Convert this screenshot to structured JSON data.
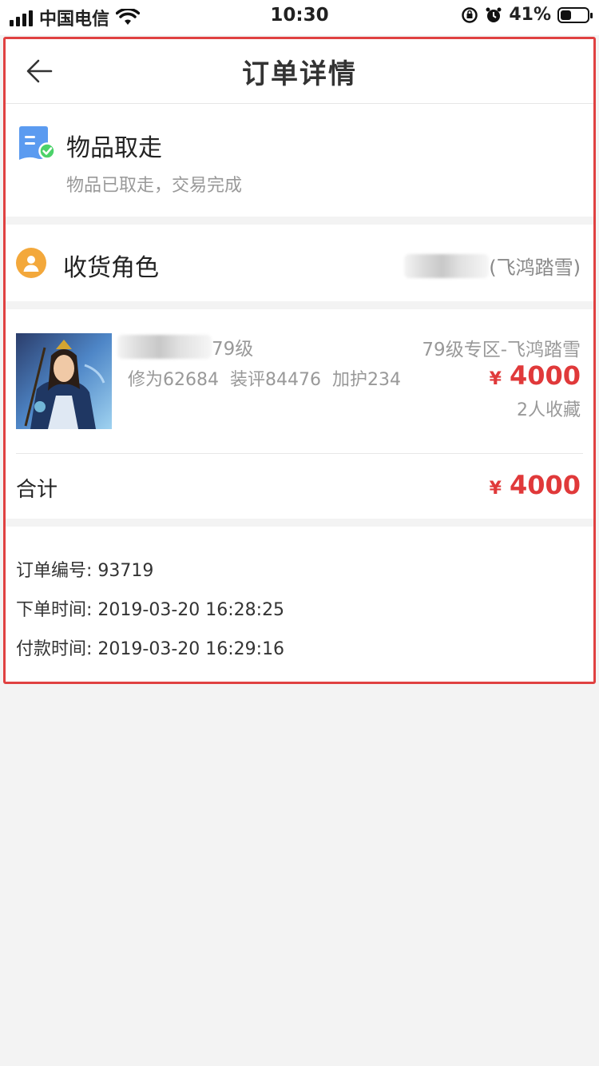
{
  "status_bar": {
    "carrier": "中国电信",
    "time": "10:30",
    "battery": "41%",
    "battery_level": 0.41
  },
  "header": {
    "title": "订单详情",
    "back_icon": "arrow-left-icon"
  },
  "order_status": {
    "icon": "document-check-icon",
    "title": "物品取走",
    "subtitle": "物品已取走，交易完成"
  },
  "receiver": {
    "icon": "user-avatar-icon",
    "label": "收货角色",
    "value_suffix": "(飞鸿踏雪)"
  },
  "goods": {
    "level": "79级",
    "zone": "79级专区-飞鸿踏雪",
    "stats": [
      "修为62684",
      "装评84476",
      "加护234"
    ],
    "price_currency": "¥",
    "price": "4000",
    "favorites": "2人收藏"
  },
  "total": {
    "label": "合计",
    "currency": "¥",
    "amount": "4000"
  },
  "order_info": {
    "order_no": "订单编号: 93719",
    "order_time": "下单时间: 2019-03-20 16:28:25",
    "pay_time": "付款时间: 2019-03-20 16:29:16"
  },
  "colors": {
    "accent_red": "#e0393a",
    "highlight_border": "#e04141",
    "role_icon": "#f3a83b",
    "status_icon": "#5b9bf0",
    "check_green": "#4cd26a"
  }
}
